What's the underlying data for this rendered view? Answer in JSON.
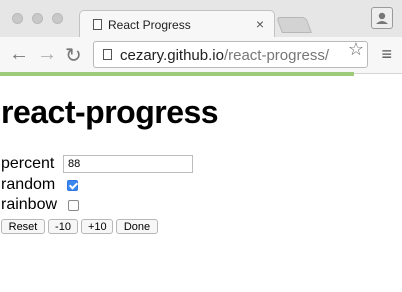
{
  "browser": {
    "tab_title": "React Progress",
    "tab_close": "×",
    "url_host": "cezary.github.io",
    "url_path": "/react-progress/",
    "back": "←",
    "forward": "→",
    "reload": "↻",
    "star": "☆",
    "menu": "≡",
    "load_progress": 0.88,
    "accent": "#9ecb79"
  },
  "page": {
    "heading": "react-progress",
    "percent_label": "percent",
    "percent_value": "88",
    "random_label": "random",
    "random_checked": true,
    "rainbow_label": "rainbow",
    "rainbow_checked": false
  },
  "buttons": {
    "reset": "Reset",
    "minus10": "-10",
    "plus10": "+10",
    "done": "Done"
  }
}
